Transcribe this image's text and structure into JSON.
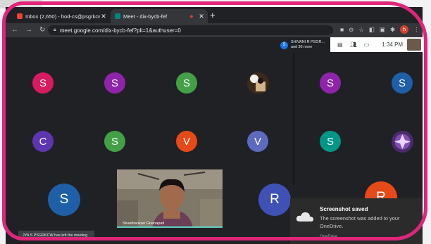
{
  "browser": {
    "tabs": [
      {
        "title": "Inbox (2,650) - hod-cs@psgrkcw",
        "icon": "gmail-icon",
        "icon_color": "#ea4335"
      },
      {
        "title": "Meet - dix-bycb-fef",
        "icon": "meet-icon",
        "icon_color": "#00897b"
      }
    ],
    "new_tab": "+",
    "url": "meet.google.com/dix-bycb-fef?pli=1&authuser=0",
    "profile_initial": "h"
  },
  "meeting": {
    "participant_name": "SHIVANI R PSGR...",
    "participant_more": "and 36 more",
    "time": "1:34 PM",
    "participants_row1": [
      "S",
      "S",
      "S",
      "S",
      "S"
    ],
    "participants_row2": [
      "C",
      "S",
      "V",
      "V",
      "S"
    ],
    "participants_row3": [
      "S",
      "R",
      "R"
    ],
    "video_name": "Sivashankari Gnanapati",
    "left_message": "JYA S PSGRKCW has left the meeting",
    "colors": {
      "pink": "#d81b60",
      "purple": "#8e24aa",
      "green": "#43a047",
      "blue": "#1e5fa8",
      "indigo": "#3f51b5",
      "teal": "#009688",
      "orange": "#e64a19",
      "slate": "#5c6bc0"
    }
  },
  "toast": {
    "title": "Screenshot saved",
    "body": "The screenshot was added to your OneDrive.",
    "source": "OneDrive"
  }
}
